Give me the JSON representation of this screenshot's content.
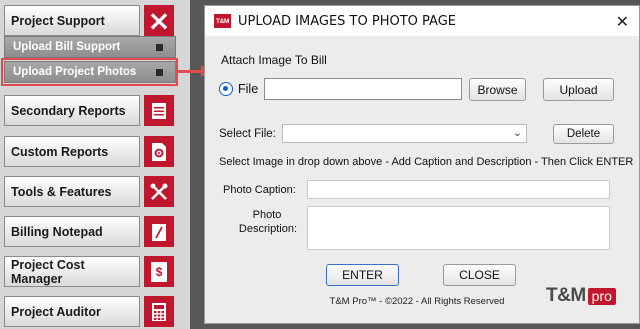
{
  "sidebar": {
    "project_support": "Project Support",
    "upload_bill_support": "Upload Bill Support",
    "upload_project_photos": "Upload Project Photos",
    "secondary_reports": "Secondary Reports",
    "custom_reports": "Custom Reports",
    "tools_features": "Tools & Features",
    "billing_notepad": "Billing Notepad",
    "project_cost_manager": "Project Cost Manager",
    "project_auditor": "Project Auditor",
    "icon_close": "×",
    "icon_dollar": "$"
  },
  "dialog": {
    "logo_badge": "T&M",
    "title": "UPLOAD IMAGES TO PHOTO PAGE",
    "close_glyph": "✕",
    "attach_label": "Attach Image To Bill",
    "file_label": "File",
    "file_value": "",
    "browse": "Browse",
    "upload": "Upload",
    "select_file_label": "Select File:",
    "select_value": "",
    "delete": "Delete",
    "instructions": "Select Image in drop down above  - Add Caption and Description - Then Click ENTER",
    "caption_label": "Photo Caption:",
    "description_label_1": "Photo",
    "description_label_2": "Description:",
    "caption_value": "",
    "description_value": "",
    "enter": "ENTER",
    "close": "CLOSE",
    "footer": "T&M Pro™ - ©2022 - All Rights Reserved",
    "brand_tm": "T&M",
    "brand_pro": "pro"
  },
  "colors": {
    "accent_red": "#c0172e",
    "highlight_red": "#e24b4b",
    "radio_blue": "#0a5fd0"
  }
}
